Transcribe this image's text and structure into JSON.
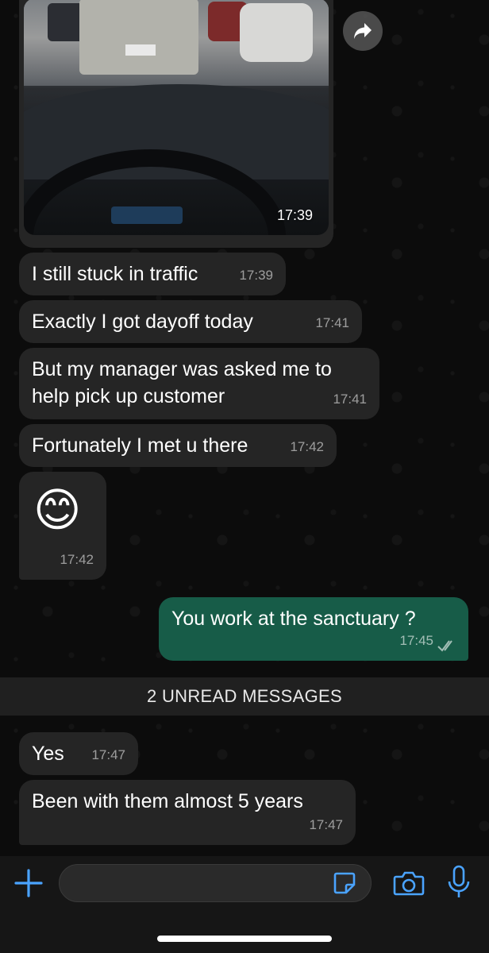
{
  "photo_message": {
    "time": "17:39"
  },
  "messages_before": [
    {
      "text": "I still stuck in traffic",
      "time": "17:39"
    },
    {
      "text": "Exactly I got dayoff today",
      "time": "17:41"
    },
    {
      "text": "But my manager was asked me to\nhelp pick up customer",
      "time": "17:41"
    },
    {
      "text": "Fortunately I met u there",
      "time": "17:42"
    },
    {
      "text": "😊",
      "time": "17:42"
    }
  ],
  "outgoing": {
    "text": "You work at the sanctuary ?",
    "time": "17:45",
    "status_icon": "double-check-icon"
  },
  "unread_divider": "2 UNREAD MESSAGES",
  "messages_after": [
    {
      "text": "Yes",
      "time": "17:47"
    },
    {
      "text": "Been with them almost 5 years",
      "time": "17:47"
    }
  ],
  "composer": {
    "placeholder": ""
  },
  "icons": {
    "forward": "forward-icon",
    "attach": "plus-icon",
    "sticker": "sticker-icon",
    "camera": "camera-icon",
    "mic": "microphone-icon"
  },
  "colors": {
    "incoming_bubble": "#252525",
    "outgoing_bubble": "#175c48",
    "accent": "#4aa3ff",
    "background": "#0b0b0b"
  }
}
